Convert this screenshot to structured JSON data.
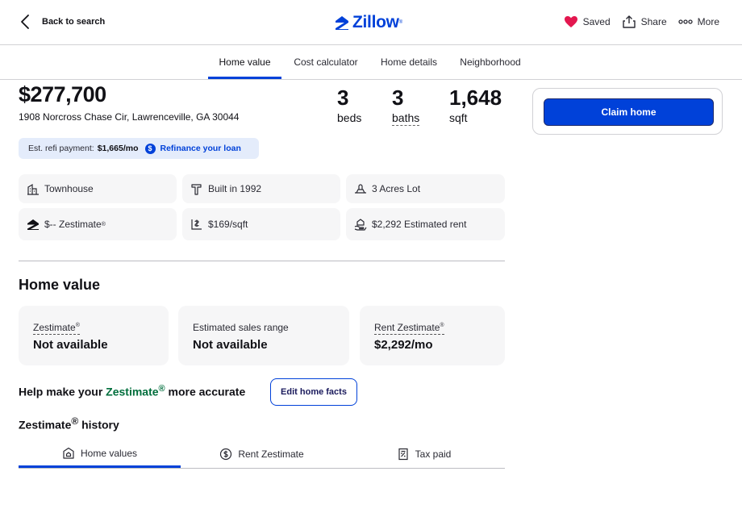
{
  "header": {
    "back_label": "Back to search",
    "logo_text": "Zillow",
    "logo_mark": "®",
    "saved_label": "Saved",
    "share_label": "Share",
    "more_label": "More",
    "brand_color": "#0041d9"
  },
  "tabs": [
    {
      "label": "Home value",
      "active": true
    },
    {
      "label": "Cost calculator",
      "active": false
    },
    {
      "label": "Home details",
      "active": false
    },
    {
      "label": "Neighborhood",
      "active": false
    }
  ],
  "listing": {
    "price": "$277,700",
    "address": "1908 Norcross Chase Cir, Lawrenceville, GA 30044",
    "beds": {
      "value": "3",
      "label": "beds"
    },
    "baths": {
      "value": "3",
      "label": "baths"
    },
    "sqft": {
      "value": "1,648",
      "label": "sqft"
    }
  },
  "refi": {
    "label": "Est. refi payment:",
    "amount": "$1,665/mo",
    "link": "Refinance your loan"
  },
  "facts": {
    "type": "Townhouse",
    "built": "Built in 1992",
    "lot": "3 Acres Lot",
    "zestimate": "$-- Zestimate",
    "price_per_sqft": "$169/sqft",
    "rent": "$2,292 Estimated rent"
  },
  "home_value": {
    "title": "Home value",
    "cards": [
      {
        "label": "Zestimate",
        "value": "Not available"
      },
      {
        "label": "Estimated sales range",
        "value": "Not available"
      },
      {
        "label": "Rent Zestimate",
        "value": "$2,292/mo"
      }
    ]
  },
  "help": {
    "prefix": "Help make your ",
    "brand": "Zestimate",
    "suffix": " more accurate",
    "edit_button": "Edit home facts"
  },
  "history": {
    "title": "Zestimate",
    "title_suffix": " history",
    "tabs": [
      {
        "label": "Home values",
        "active": true
      },
      {
        "label": "Rent Zestimate",
        "active": false
      },
      {
        "label": "Tax paid",
        "active": false
      }
    ]
  },
  "claim": {
    "button": "Claim home"
  }
}
